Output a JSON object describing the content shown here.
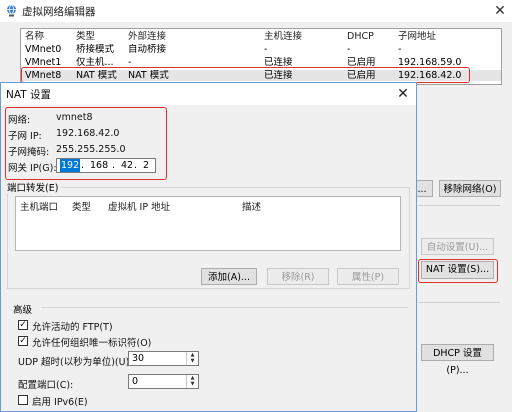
{
  "main": {
    "title": "虚拟网络编辑器",
    "columns": [
      "名称",
      "类型",
      "外部连接",
      "主机连接",
      "DHCP",
      "子网地址"
    ],
    "rows": [
      [
        "VMnet0",
        "桥接模式",
        "自动桥接",
        "-",
        "-",
        "-"
      ],
      [
        "VMnet1",
        "仅主机...",
        "-",
        "已连接",
        "已启用",
        "192.168.59.0"
      ],
      [
        "VMnet8",
        "NAT 模式",
        "NAT 模式",
        "已连接",
        "已启用",
        "192.168.42.0"
      ]
    ],
    "btn_partial": "...",
    "btn_remove_network": "移除网络(O)",
    "btn_auto": "自动设置(U)...",
    "btn_nat": "NAT 设置(S)...",
    "btn_dhcp": "DHCP 设置(P)..."
  },
  "nat": {
    "title": "NAT 设置",
    "network_label": "网络:",
    "network_value": "vmnet8",
    "subnet_ip_label": "子网 IP:",
    "subnet_ip_value": "192.168.42.0",
    "mask_label": "子网掩码:",
    "mask_value": "255.255.255.0",
    "gateway_label": "网关 IP(G):",
    "gateway": [
      "192",
      "168",
      "42",
      "2"
    ],
    "port_forward_label": "端口转发(E)",
    "pf_columns": [
      "主机端口",
      "类型",
      "虚拟机 IP 地址",
      "描述"
    ],
    "btn_add": "添加(A)...",
    "btn_remove": "移除(R)",
    "btn_properties": "属性(P)",
    "advanced_label": "高级",
    "allow_ftp": "允许活动的 FTP(T)",
    "allow_any_oui": "允许任何组织唯一标识符(O)",
    "udp_timeout_label": "UDP 超时(以秒为单位)(U):",
    "udp_timeout_value": "30",
    "config_port_label": "配置端口(C):",
    "config_port_value": "0",
    "partial_bottom": "启用 IPv6(E)"
  }
}
